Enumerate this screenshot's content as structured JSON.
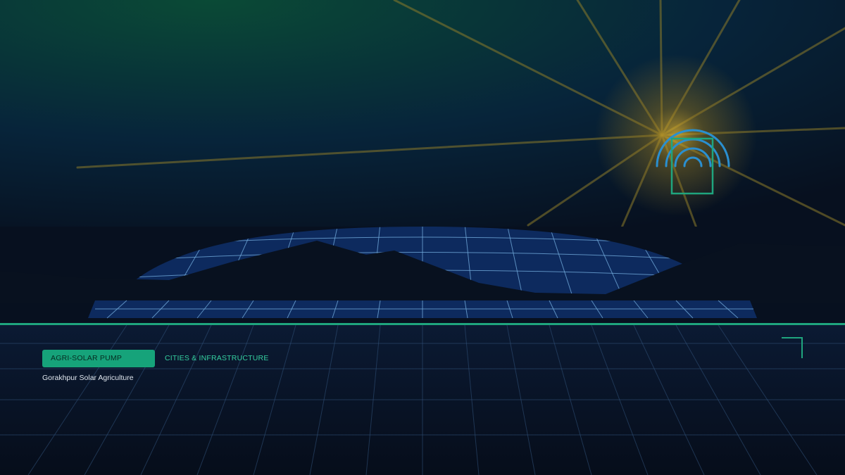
{
  "tags": {
    "active_label": "AGRI-SOLAR PUMP",
    "inactive_label": "CITIES & INFRASTRUCTURE"
  },
  "caption": "Gorakhpur Solar Agriculture",
  "colors": {
    "sky_top": "#0a4a36",
    "sky_bottom": "#07101f",
    "panel_fill": "#0d2a5e",
    "panel_grid": "#6fa8d8",
    "accent_green": "#1fa57e",
    "sun_glow": "#c8a020",
    "signal_blue": "#2a8fd0",
    "mountain": "#08111f"
  },
  "icons": {
    "sun": "sun-glow-icon",
    "pump_signal": "wireless-signal-icon"
  }
}
